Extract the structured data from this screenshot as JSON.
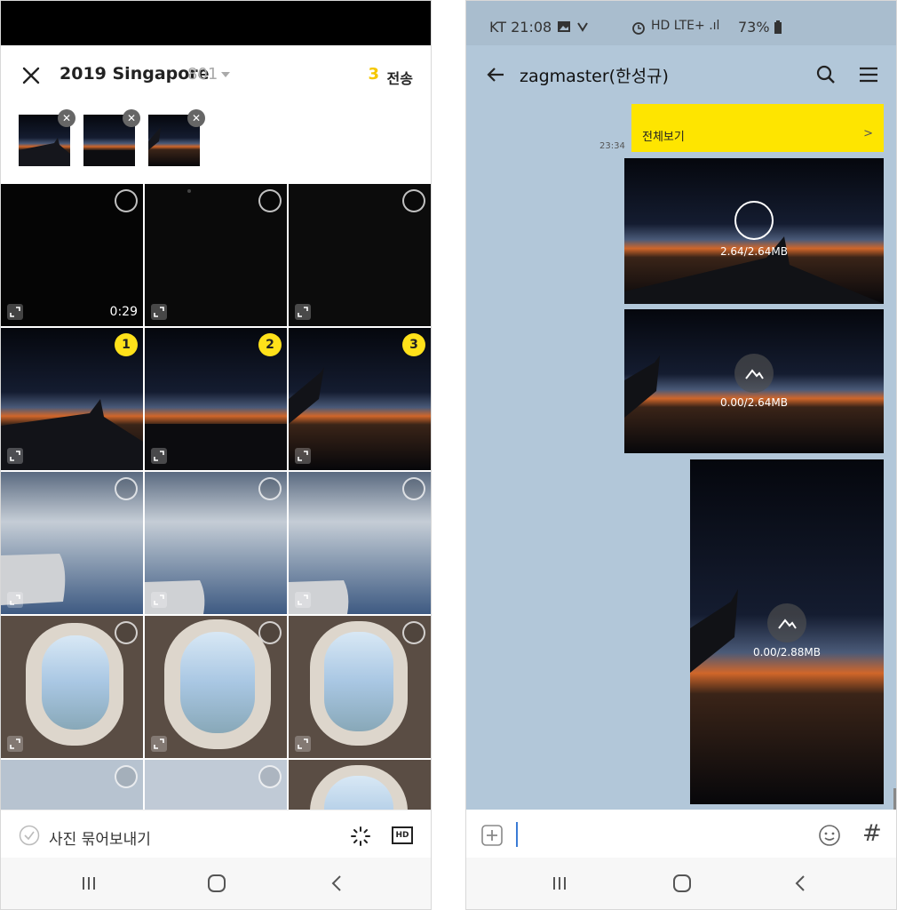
{
  "picker": {
    "album_title": "2019 Singapore",
    "album_count": "801",
    "send_count": "3",
    "send_label": "전송",
    "video_duration": "0:29",
    "selection_numbers": [
      "1",
      "2",
      "3"
    ],
    "bundle_label": "사진 묶어보내기",
    "hd_label": "HD"
  },
  "status_bar": {
    "time_carrier": "KT 21:08",
    "icons_text": "HD LTE+ .ıl",
    "battery": "73%"
  },
  "chat": {
    "title": "zagmaster(한성규)",
    "view_all_label": "전체보기",
    "view_all_chevron": ">",
    "message_time": "23:34",
    "downloads": [
      "2.64/2.64MB",
      "0.00/2.64MB",
      "0.00/2.88MB"
    ],
    "hashtag_label": "#"
  },
  "colors": {
    "accent_yellow": "#fee500",
    "selection_yellow": "#ffe11a",
    "chat_background": "#b2c7d9"
  }
}
